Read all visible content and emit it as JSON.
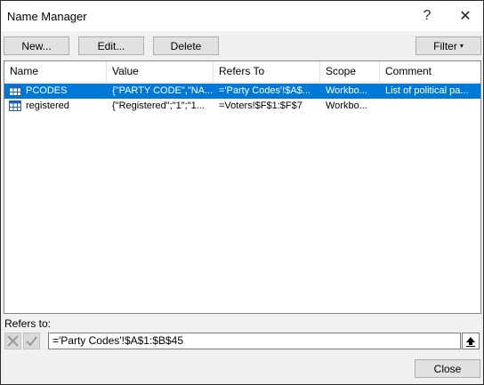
{
  "window": {
    "title": "Name Manager",
    "help": "?",
    "close": "✕"
  },
  "toolbar": {
    "new_label": "New...",
    "edit_label": "Edit...",
    "delete_label": "Delete",
    "filter_label": "Filter"
  },
  "columns": [
    "Name",
    "Value",
    "Refers To",
    "Scope",
    "Comment"
  ],
  "names": [
    {
      "name": "PCODES",
      "value": "{\"PARTY CODE\",\"NA...",
      "refers_to": "='Party Codes'!$A$...",
      "scope": "Workbo...",
      "comment": "List of political pa...",
      "selected": true
    },
    {
      "name": "registered",
      "value": "{\"Registered\";\"1\";\"1...",
      "refers_to": "=Voters!$F$1:$F$7",
      "scope": "Workbo...",
      "comment": "",
      "selected": false
    }
  ],
  "refers_to_label": "Refers to:",
  "refers_to_value": "='Party Codes'!$A$1:$B$45",
  "close_label": "Close",
  "colors": {
    "selection": "#0078d7",
    "table_icon": "#1f5fbf"
  }
}
